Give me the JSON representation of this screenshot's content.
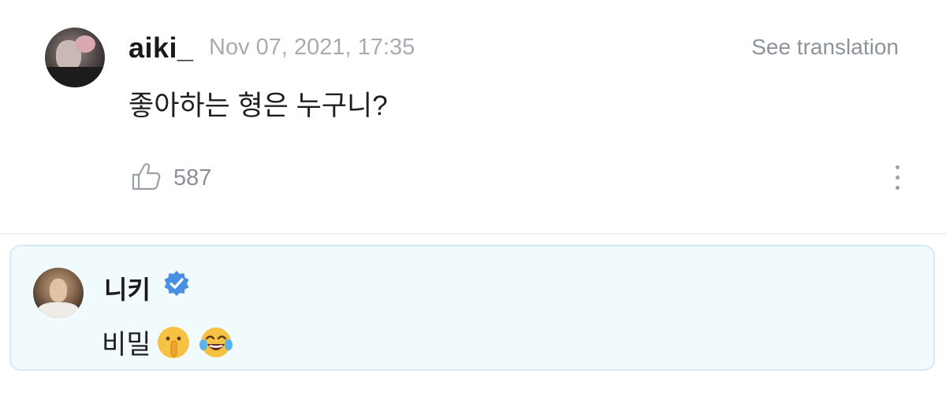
{
  "comment": {
    "username": "aiki_",
    "timestamp": "Nov 07, 2021, 17:35",
    "translate_label": "See translation",
    "text": "좋아하는 형은 누구니?",
    "like_count": "587",
    "like_icon": "thumbs-up-icon",
    "menu_icon": "more-vertical-icon"
  },
  "reply": {
    "username": "니키",
    "verified": true,
    "verified_color": "#4a90e2",
    "text": "비밀",
    "emojis": [
      "shushing-face-emoji",
      "tears-of-joy-emoji"
    ]
  },
  "colors": {
    "reply_background": "#f1fafd",
    "reply_border": "#d6ecf3",
    "muted_text": "#a7acb3"
  }
}
